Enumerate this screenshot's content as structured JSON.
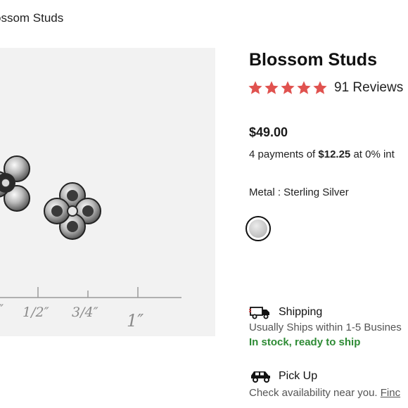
{
  "breadcrumb": {
    "current": "ossom Studs"
  },
  "product": {
    "title": "Blossom Studs",
    "rating": 5,
    "reviews_label": "91 Reviews",
    "price": "$49.00",
    "installments": {
      "prefix": "4 payments of ",
      "amount": "$12.25",
      "suffix": " at 0% int"
    },
    "metal_label": "Metal : Sterling Silver",
    "swatch_color": "#c9c9c9"
  },
  "image": {
    "ruler_labels": [
      "″",
      "1/2″",
      "3/4″",
      "1″"
    ],
    "icons": [
      "heart-icon"
    ]
  },
  "shipping": {
    "label": "Shipping",
    "subtext": "Usually Ships within 1-5 Busines",
    "stock": "In stock, ready to ship",
    "icon": "truck-icon"
  },
  "pickup": {
    "label": "Pick Up",
    "subtext": "Check availability near you. ",
    "link": "Finc",
    "icon": "car-icon"
  },
  "colors": {
    "star": "#e0524f",
    "stock": "#2e8b35",
    "heart": "#e0524f"
  }
}
